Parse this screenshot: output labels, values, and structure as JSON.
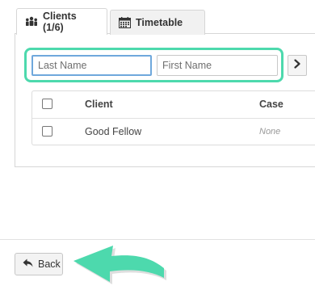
{
  "tabs": {
    "clients_label": "Clients (1/6)",
    "timetable_label": "Timetable"
  },
  "search": {
    "last_name_placeholder": "Last Name",
    "first_name_placeholder": "First Name"
  },
  "grid": {
    "columns": [
      "Client",
      "Case"
    ],
    "rows": [
      {
        "client": "Good Fellow",
        "case": "None"
      }
    ]
  },
  "footer": {
    "back_label": "Back"
  },
  "colors": {
    "highlight": "#4dd9ad",
    "focus": "#6fa8dc"
  },
  "icons": {
    "clients_tab": "users-icon",
    "timetable_tab": "calendar-icon",
    "next": "chevron-right-icon",
    "back": "reply-arrow-icon",
    "annotation": "curved-arrow-icon"
  }
}
